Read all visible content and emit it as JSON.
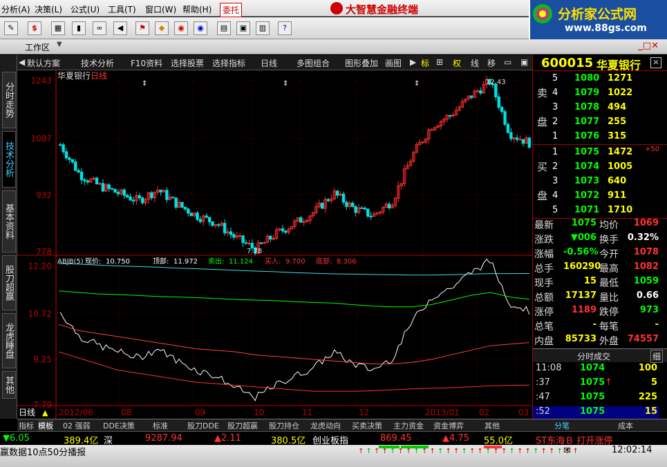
{
  "menu": {
    "items": [
      "分析(A)",
      "决策(L)",
      "公式(U)",
      "工具(T)",
      "窗口(W)",
      "帮助(H)"
    ],
    "weituo": "委托",
    "app_title": "大智慧金融终端"
  },
  "logo": {
    "text": "分析家公式网",
    "url": "www.88gs.com"
  },
  "toolbar": {
    "icons": [
      "pencil-icon",
      "dollar-icon",
      "quote-icon",
      "bars-icon",
      "binoculars-icon",
      "speaker-icon",
      "flag-icon",
      "diamond-icon",
      "rss-icon",
      "rss-icon",
      "printer-icon",
      "window-icon",
      "books-icon",
      "help-icon"
    ]
  },
  "workbar": {
    "label": "工作区"
  },
  "left_tabs": [
    "分时走势",
    "技术分析",
    "基本资料",
    "股刀超赢",
    "龙虎睡盘",
    "其他"
  ],
  "chart_menu": {
    "items": [
      "默认方案",
      "技术分析",
      "F10资料",
      "选择股票",
      "选择指标",
      "日线",
      "多图组合",
      "图形叠加",
      "画图"
    ],
    "right_items": [
      "标",
      "权",
      "线",
      "移"
    ]
  },
  "chart": {
    "title": "华夏银行",
    "period": "日线",
    "price_ticks": [
      "1243",
      "1087",
      "932",
      "778"
    ],
    "high_label": "12.43",
    "low_label": "7.78",
    "indicator_name": "ABJB(5)",
    "indicator_fields": [
      {
        "label": "现价:",
        "value": "10.750"
      },
      {
        "label": "顶部:",
        "value": "11.972"
      },
      {
        "label": "卖出:",
        "value": "11.124"
      },
      {
        "label": "买入:",
        "value": "9.700"
      },
      {
        "label": "底部:",
        "value": "8.306"
      }
    ],
    "indicator_ticks": [
      "12.20",
      "10.72",
      "9.25",
      "7.79"
    ],
    "date_labels": [
      "2012/06",
      "08",
      "09",
      "10",
      "11",
      "12",
      "2013/01",
      "02",
      "03"
    ],
    "period_tag": "日线"
  },
  "chart_data": {
    "type": "line",
    "title": "华夏银行",
    "xlabel": "",
    "ylabel": "",
    "ylim": [
      7.78,
      12.43
    ],
    "series": [
      {
        "name": "现价",
        "values": [
          10.7,
          9.9,
          9.6,
          9.4,
          9.2,
          9.5,
          9.1,
          8.8,
          8.6,
          8.2,
          7.9,
          8.3,
          8.6,
          8.9,
          9.4,
          9.0,
          8.8,
          9.2,
          10.4,
          11.2,
          11.5,
          12.0,
          12.4,
          11.0,
          10.75
        ]
      },
      {
        "name": "顶部",
        "values": [
          12.3,
          12.28,
          12.25,
          12.22,
          12.2,
          12.18,
          12.15,
          12.13,
          12.1,
          12.08,
          12.05,
          12.03,
          12.0,
          11.98,
          11.96,
          11.95,
          11.94,
          11.93,
          11.92,
          11.92,
          11.93,
          11.95,
          11.97,
          11.97,
          11.972
        ]
      },
      {
        "name": "卖出",
        "values": [
          11.4,
          11.35,
          11.3,
          11.28,
          11.25,
          11.22,
          11.2,
          11.18,
          11.15,
          11.12,
          11.1,
          11.08,
          11.05,
          11.02,
          11.0,
          10.95,
          10.9,
          10.88,
          10.88,
          10.95,
          11.1,
          11.25,
          11.35,
          11.2,
          11.124
        ]
      },
      {
        "name": "买入",
        "values": [
          10.3,
          10.1,
          10.0,
          9.9,
          9.8,
          9.7,
          9.6,
          9.5,
          9.45,
          9.4,
          9.3,
          9.25,
          9.2,
          9.15,
          9.1,
          9.05,
          9.0,
          9.0,
          9.05,
          9.15,
          9.3,
          9.45,
          9.6,
          9.65,
          9.7
        ]
      },
      {
        "name": "底部",
        "values": [
          9.4,
          9.2,
          9.0,
          8.8,
          8.7,
          8.6,
          8.5,
          8.4,
          8.35,
          8.3,
          8.25,
          8.2,
          8.15,
          8.1,
          8.1,
          8.1,
          8.12,
          8.15,
          8.18,
          8.2,
          8.22,
          8.25,
          8.28,
          8.3,
          8.306
        ]
      }
    ]
  },
  "stock": {
    "code": "600015",
    "name": "华夏银行"
  },
  "order_book": {
    "sell_label": [
      "卖",
      "盘"
    ],
    "buy_label": [
      "买",
      "盘"
    ],
    "sell": [
      [
        "5",
        "1080",
        "1271"
      ],
      [
        "4",
        "1079",
        "1022"
      ],
      [
        "3",
        "1078",
        "494"
      ],
      [
        "2",
        "1077",
        "255"
      ],
      [
        "1",
        "1076",
        "315"
      ]
    ],
    "buy": [
      [
        "1",
        "1075",
        "1472"
      ],
      [
        "2",
        "1074",
        "1005"
      ],
      [
        "3",
        "1073",
        "640"
      ],
      [
        "4",
        "1072",
        "911"
      ],
      [
        "5",
        "1071",
        "1710"
      ]
    ],
    "buy_note": "+50"
  },
  "quote": [
    [
      "最新",
      "1075",
      "均价",
      "1069"
    ],
    [
      "涨跌",
      "▼006",
      "换手",
      "0.32%"
    ],
    [
      "涨幅",
      "-0.56%",
      "今开",
      "1078"
    ],
    [
      "总手",
      "160290",
      "最高",
      "1082"
    ],
    [
      "现手",
      "15",
      "最低",
      "1059"
    ],
    [
      "总额",
      "17137",
      "量比",
      "0.66"
    ],
    [
      "涨停",
      "1189",
      "跌停",
      "973"
    ],
    [
      "总笔",
      "-",
      "每笔",
      "-"
    ],
    [
      "内盘",
      "85733",
      "外盘",
      "74557"
    ]
  ],
  "trades": {
    "header": "分时成交",
    "detail": "细",
    "rows": [
      [
        "11:08",
        "1074",
        "100"
      ],
      [
        ":37",
        "1075",
        "5"
      ],
      [
        ":47",
        "1075",
        "225"
      ],
      [
        ":52",
        "1075",
        "15"
      ]
    ]
  },
  "bottom_tabs": [
    "指标",
    "模板",
    "02 强弱",
    "DDE决策",
    "标准",
    "股刀DDE",
    "股刀超赢",
    "股刀持仓",
    "龙虎动向",
    "买卖决策",
    "主力资金",
    "资金博弈",
    "其他"
  ],
  "right_tabs": [
    "分笔",
    "成本"
  ],
  "ticker": {
    "items": [
      "▼6.05",
      "389.4亿",
      "深",
      "9287.94",
      "▲2.11",
      "380.5亿",
      "创业板指",
      "869.45",
      "▲4.75",
      "55.0亿",
      "ST东海Ｂ 打开涨停"
    ]
  },
  "status": {
    "text": "赢数据10点50分播报",
    "clock": "12:02:14"
  },
  "colors": {
    "up": "#ff3030",
    "down": "#00e0e0",
    "grid": "#a00000",
    "yellow": "#ffff00",
    "green": "#00ff00"
  }
}
